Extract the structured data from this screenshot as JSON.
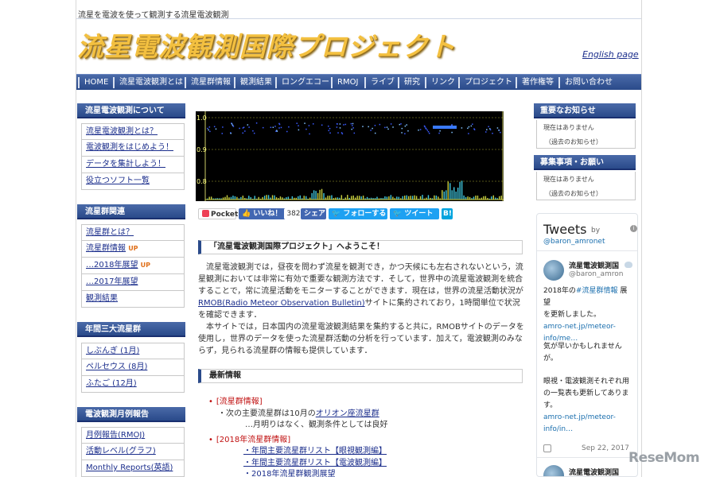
{
  "header": {
    "tagline": "流星を電波を使って観測する流星電波観測",
    "logo_text": "流星電波観測国際プロジェクト",
    "english_link": "English page"
  },
  "nav": [
    "HOME",
    "流星電波観測とは",
    "流星群情報",
    "観測結果",
    "ロングエコー",
    "RMOJ",
    "ライブ",
    "研究",
    "リンク",
    "プロジェクト",
    "著作権等",
    "お問い合わせ"
  ],
  "left": {
    "about": {
      "title": "流星電波観測について",
      "items": [
        "流星電波観測とは？",
        "電波観測をはじめよう！",
        "データを集計しよう！",
        "役立つソフト一覧"
      ]
    },
    "showers": {
      "title": "流星群関連",
      "items": [
        {
          "label": "流星群とは？",
          "badge": ""
        },
        {
          "label": "流星群情報",
          "badge": "UP"
        },
        {
          "label": "…2018年展望",
          "badge": "UP"
        },
        {
          "label": "…2017年展望",
          "badge": ""
        },
        {
          "label": "観測結果",
          "badge": ""
        }
      ]
    },
    "major": {
      "title": "年間三大流星群",
      "items": [
        "しぶんぎ (1月)",
        "ペルセウス (8月)",
        "ふたご (12月)"
      ]
    },
    "monthly": {
      "title": "電波観測月例報告",
      "items": [
        "月例報告(RMOJ)",
        "活動レベル(グラフ)",
        "Monthly Reports(英語)"
      ]
    }
  },
  "right": {
    "notice": {
      "title": "重要なお知らせ",
      "line1": "現在はありません",
      "line2": "（過去のお知らせ）"
    },
    "recruit": {
      "title": "募集事項・お願い",
      "line1": "現在はありません",
      "line2": "（過去のお知らせ）"
    },
    "twitter": {
      "title": "Tweets",
      "by": "by",
      "handle": "@baron_amronet",
      "info": "i",
      "tweet1": {
        "name": "流星電波観測国",
        "acct": "@baron_amron",
        "lines": [
          "2018年の",
          "#流星群情報",
          " 展望",
          "を更新しました。",
          "amro-net.jp/meteor-",
          "info/me…"
        ],
        "lines2": [
          "気が早いかもしれませんが。"
        ],
        "lines3": [
          "眼視・電波観測それぞれ用の一覧表も更新してあります。",
          "amro-net.jp/meteor-",
          "info/in…"
        ],
        "date": "Sep 22, 2017"
      },
      "tweet2": {
        "name": "流星電波観測国"
      }
    }
  },
  "chart_data": {
    "type": "bar",
    "yticks": [
      "1.0",
      "0.9",
      "0.8"
    ],
    "background": "#000000"
  },
  "social": {
    "pocket": "Pocket",
    "like": "いいね！",
    "like_count": "382",
    "share": "シェア",
    "follow": "フォローする",
    "tweet": "ツイート",
    "hatena": "B!"
  },
  "welcome": {
    "title": "「流星電波観測国際プロジェクト」へようこそ！",
    "p1a": "流星電波観測では，昼夜を問わず流星を観測でき，かつ天候にも左右されないという，流星観測においては非常に有効で重要な観測方法です．そして，世界中の流星電波観測を統合することで，常に流星活動をモニターすることができます．現在は，世界の流星活動状況が",
    "p1link": "RMOB(Radio Meteor Observation Bulletin)",
    "p1b": "サイトに集約されており，1時間単位で状況を確認できます．",
    "p2": "本サイトでは，日本国内の流星電波観測結果を集約すると共に，RMOBサイトのデータを使用し，世界のデータを使った流星群活動の分析を行っています．加えて，電波観測のみならず，見られる流星群の情報も提供しています．"
  },
  "latest": {
    "title": "最新情報",
    "items": [
      {
        "cat": "[流星群情報]",
        "l1a": "・次の主要流星群は10月の",
        "l1link": "オリオン座流星群",
        "l2": "…月明りはなく、観測条件としては良好"
      },
      {
        "cat": "[2018年流星群情報]",
        "links": [
          "・年間主要流星群リスト【眼視観測編】",
          "・年間主要流星群リスト【電波観測編】",
          "・2018年流星群観測展望"
        ]
      }
    ]
  },
  "watermark": "ReseMom"
}
